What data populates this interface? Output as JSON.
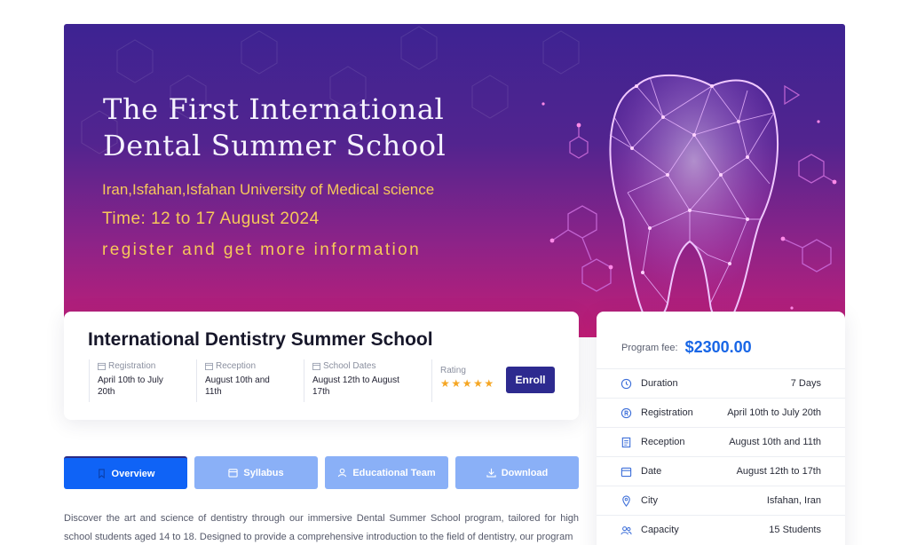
{
  "banner": {
    "title_line1": "The First International",
    "title_line2": "Dental Summer School",
    "location": "Iran,Isfahan,Isfahan University of Medical science",
    "time": "Time: 12 to 17 August 2024",
    "cta": "register and get more information",
    "art_icon": "tooth-icon"
  },
  "course": {
    "title": "International Dentistry Summer School",
    "registration": {
      "label": "Registration",
      "value": "April 10th to July 20th",
      "icon": "calendar-icon"
    },
    "reception": {
      "label": "Reception",
      "value": "August 10th and 11th",
      "icon": "calendar-icon"
    },
    "school_dates": {
      "label": "School Dates",
      "value": "August 12th to August 17th",
      "icon": "calendar-icon"
    },
    "rating": {
      "label": "Rating",
      "stars": "★★★★★",
      "value": 5,
      "max": 5
    },
    "enroll_label": "Enroll"
  },
  "tabs": [
    {
      "label": "Overview",
      "icon": "bookmark-icon",
      "active": true
    },
    {
      "label": "Syllabus",
      "icon": "calendar-icon",
      "active": false
    },
    {
      "label": "Educational Team",
      "icon": "user-icon",
      "active": false
    },
    {
      "label": "Download",
      "icon": "download-icon",
      "active": false
    }
  ],
  "description": "Discover the art and science of dentistry through our immersive Dental Summer School program, tailored for high school students aged 14 to 18. Designed to provide a comprehensive introduction to the field of dentistry, our program",
  "info": {
    "fee_label": "Program fee:",
    "fee_value": "$2300.00",
    "rows": [
      {
        "label": "Duration",
        "value": "7 Days",
        "icon": "clock-icon"
      },
      {
        "label": "Registration",
        "value": "April 10th to July 20th",
        "icon": "registered-icon"
      },
      {
        "label": "Reception",
        "value": "August 10th and 11th",
        "icon": "document-icon"
      },
      {
        "label": "Date",
        "value": "August 12th to 17th",
        "icon": "calendar-icon"
      },
      {
        "label": "City",
        "value": "Isfahan, Iran",
        "icon": "map-pin-icon"
      },
      {
        "label": "Capacity",
        "value": "15 Students",
        "icon": "users-icon"
      }
    ]
  },
  "colors": {
    "banner_top": "#3d2392",
    "banner_bottom": "#c21d75",
    "banner_text_accent": "#f7c85a",
    "enroll_bg": "#2d2a8f",
    "tab_active": "#0f63f6",
    "tab_idle": "#8ab0f7",
    "fee_value": "#1866e6",
    "star": "#f5a623"
  }
}
